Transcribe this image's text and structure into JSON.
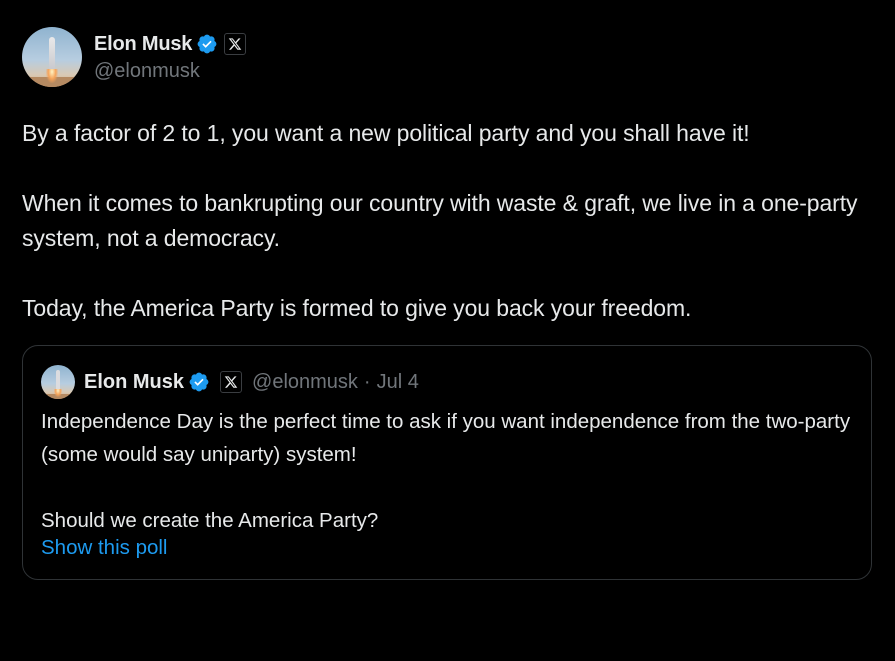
{
  "tweet": {
    "display_name": "Elon Musk",
    "handle": "@elonmusk",
    "avatar_icon": "rocket-launch-avatar",
    "verified_icon": "verified-badge-icon",
    "affiliation_icon": "x-logo-icon",
    "body": "By a factor of 2 to 1, you want a new political party and you shall have it!\n\nWhen it comes to bankrupting our country with waste & graft, we live in a one-party system, not a democracy.\n\nToday, the America Party is formed to give you back your freedom."
  },
  "quoted_tweet": {
    "display_name": "Elon Musk",
    "handle": "@elonmusk",
    "separator": "·",
    "date": "Jul 4",
    "body": "Independence Day is the perfect time to ask if you want independence from the two-party (some would say uniparty) system!\n\nShould we create the America Party?",
    "poll_link": "Show this poll"
  },
  "colors": {
    "background": "#000000",
    "text_primary": "#e7e9ea",
    "text_secondary": "#71767b",
    "accent_blue": "#1d9bf0",
    "border": "#2f3336"
  }
}
